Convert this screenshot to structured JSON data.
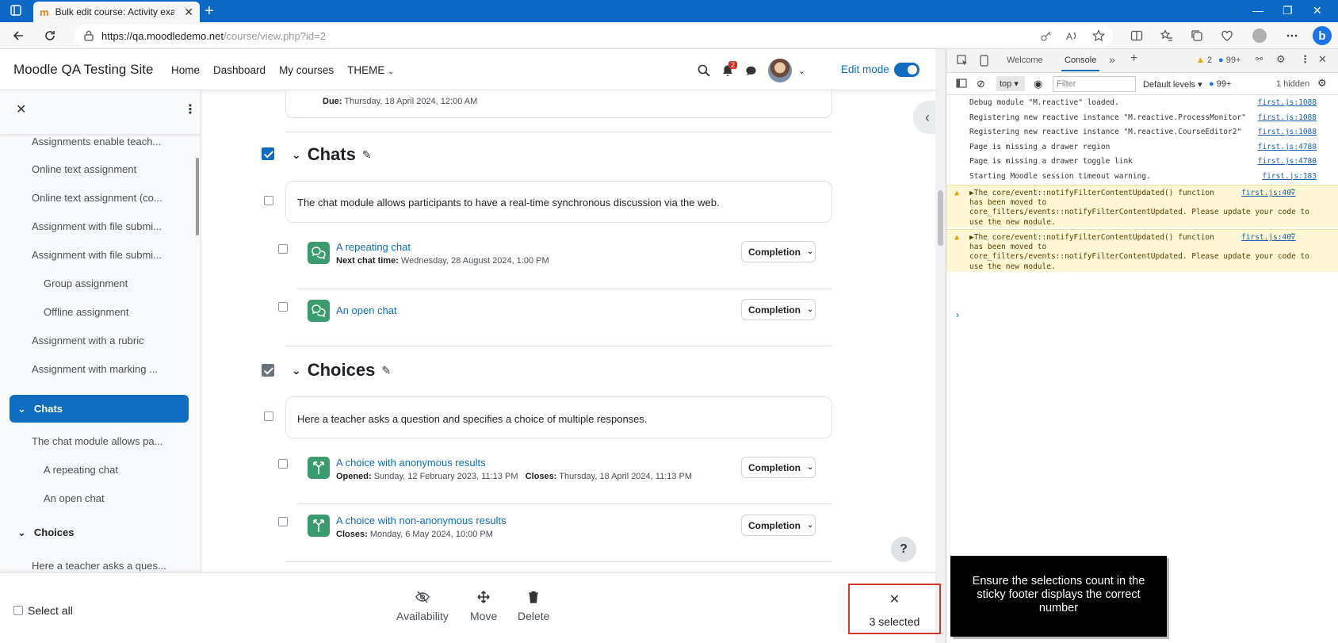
{
  "browser": {
    "tab_title": "Bulk edit course: Activity example",
    "favicon": "m",
    "url_host": "https://qa.moodledemo.net",
    "url_path": "/course/view.php?id=2"
  },
  "moodle": {
    "site_name": "Moodle QA Testing Site",
    "nav": [
      "Home",
      "Dashboard",
      "My courses",
      "THEME"
    ],
    "notif_count": "2",
    "edit_mode_label": "Edit mode",
    "drawer_items": {
      "i0": "Assignments enable teach...",
      "i1": "Online text assignment",
      "i2": "Online text assignment (co...",
      "i3": "Assignment with file submi...",
      "i4": "Assignment with file submi...",
      "i5": "Group assignment",
      "i6": "Offline assignment",
      "i7": "Assignment with a rubric",
      "i8": "Assignment with marking ...",
      "chats_section": "Chats",
      "i9": "The chat module allows pa...",
      "i10": "A repeating chat",
      "i11": "An open chat",
      "choices_section": "Choices",
      "i12": "Here a teacher asks a ques..."
    },
    "due_label": "Due:",
    "due_value": "Thursday, 18 April 2024, 12:00 AM",
    "sections": {
      "chats": {
        "title": "Chats",
        "summary": "The chat module allows participants to have a real-time synchronous discussion via the web.",
        "act1_name": "A repeating chat",
        "act1_meta_label": "Next chat time:",
        "act1_meta_value": "Wednesday, 28 August 2024, 1:00 PM",
        "act2_name": "An open chat"
      },
      "choices": {
        "title": "Choices",
        "summary": "Here a teacher asks a question and specifies a choice of multiple responses.",
        "act1_name": "A choice with anonymous results",
        "act1_opened_label": "Opened:",
        "act1_opened_value": "Sunday, 12 February 2023, 11:13 PM",
        "act1_closes_label": "Closes:",
        "act1_closes_value": "Thursday, 18 April 2024, 11:13 PM",
        "act2_name": "A choice with non-anonymous results",
        "act2_closes_label": "Closes:",
        "act2_closes_value": "Monday, 6 May 2024, 10:00 PM"
      }
    },
    "completion_label": "Completion",
    "help_label": "?",
    "footer": {
      "select_all": "Select all",
      "availability": "Availability",
      "move": "Move",
      "delete": "Delete",
      "close": "✕",
      "selected_count": "3 selected"
    }
  },
  "devtools": {
    "tabs": [
      "Welcome",
      "Console"
    ],
    "warn_count": "2",
    "msg_count": "99+",
    "context": "top",
    "filter_placeholder": "Filter",
    "levels": "Default levels",
    "issues_count": "99+",
    "hidden": "1 hidden",
    "logs": [
      {
        "text": "Debug module \"M.reactive\" loaded.",
        "src": "first.js:1088"
      },
      {
        "text": "Registering new reactive instance \"M.reactive.ProcessMonitor\"",
        "src": "first.js:1088"
      },
      {
        "text": "Registering new reactive instance \"M.reactive.CourseEditor2\"",
        "src": "first.js:1088"
      },
      {
        "text": "Page is missing a drawer region",
        "src": "first.js:4780"
      },
      {
        "text": "Page is missing a drawer toggle link",
        "src": "first.js:4780"
      },
      {
        "text": "Starting Moodle session timeout warning.",
        "src": "first.js:183"
      }
    ],
    "warnings": [
      {
        "l1": "▶The core/event::notifyFilterContentUpdated() function",
        "l2": "has been moved to",
        "l3": "core_filters/events::notifyFilterContentUpdated. Please update your code to",
        "l4": "use the new module.",
        "src": "first.js:407"
      },
      {
        "l1": "▶The core/event::notifyFilterContentUpdated() function",
        "l2": "has been moved to",
        "l3": "core_filters/events::notifyFilterContentUpdated. Please update your code to",
        "l4": "use the new module.",
        "src": "first.js:407"
      }
    ]
  },
  "callout": "Ensure the selections count in the sticky footer displays the correct number"
}
